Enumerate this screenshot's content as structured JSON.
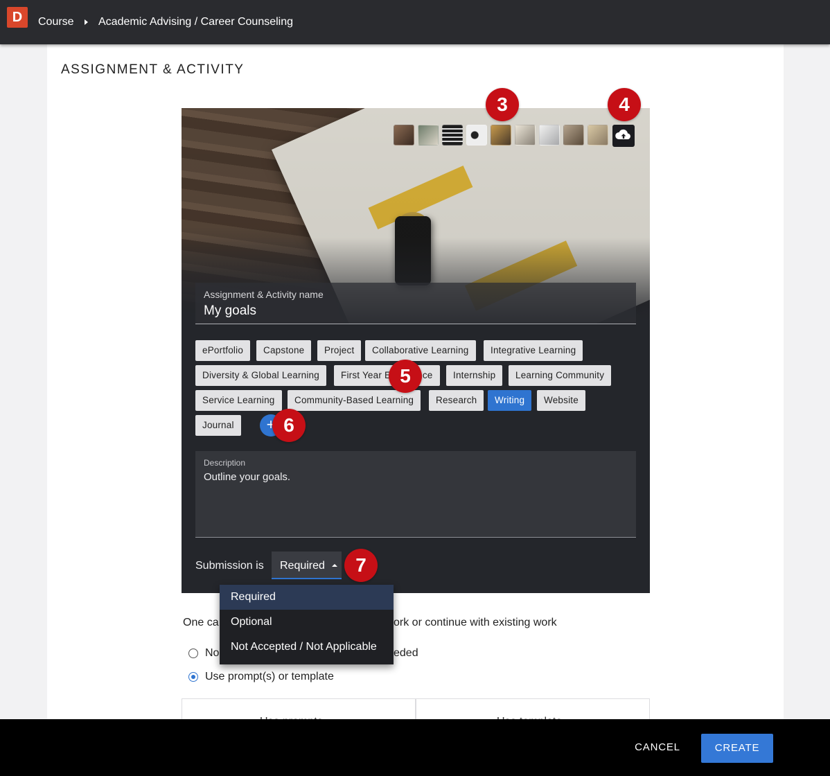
{
  "header": {
    "logo_letter": "D",
    "breadcrumb": [
      "Course",
      "Academic Advising / Career Counseling"
    ]
  },
  "page": {
    "title": "ASSIGNMENT & ACTIVITY"
  },
  "card": {
    "thumbnail_count": 9,
    "upload_icon": "cloud-upload-icon",
    "name_field": {
      "label": "Assignment & Activity name",
      "value": "My goals"
    },
    "tags": [
      "ePortfolio",
      "Capstone",
      "Project",
      "Collaborative Learning",
      "Integrative Learning",
      "Diversity & Global Learning",
      "First Year Experience",
      "Internship",
      "Learning Community",
      "Service Learning",
      "Community-Based Learning",
      "Research",
      "Writing",
      "Website",
      "Journal"
    ],
    "active_tag": "Writing",
    "add_tag_label": "+",
    "description": {
      "label": "Description",
      "value": "Outline your goals."
    },
    "submission": {
      "label": "Submission is",
      "value": "Required"
    }
  },
  "dropdown": {
    "options": [
      "Required",
      "Optional",
      "Not Accepted / Not Applicable"
    ],
    "selected": "Required"
  },
  "below": {
    "continue_text_start": "One ca",
    "continue_text_end": "ork or continue with existing work",
    "radio_1_start": "No",
    "radio_1_end": "eded",
    "radio_2": "Use prompt(s) or template",
    "option_left": "Use prompts",
    "option_right": "Use template"
  },
  "footer": {
    "cancel": "CANCEL",
    "create": "CREATE"
  },
  "annotations": [
    "3",
    "4",
    "5",
    "6",
    "7"
  ],
  "colors": {
    "accent": "#2f74d0",
    "badge": "#c60f16",
    "logo": "#d9472b"
  }
}
